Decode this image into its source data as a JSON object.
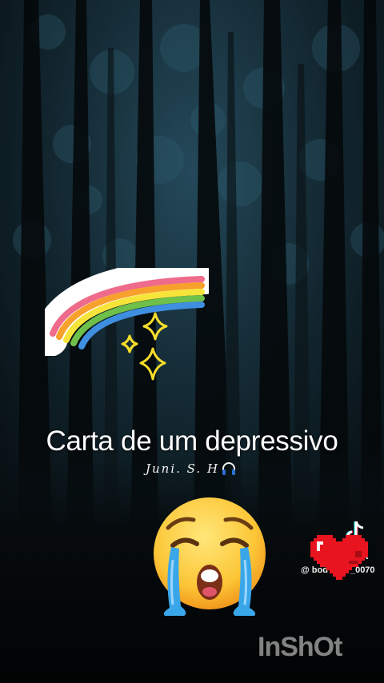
{
  "caption": "Carta de um depressivo",
  "signature": "Juni. S. H",
  "tiktok": {
    "brand": "ok",
    "handle": "@ bod",
    "handle_suffix": "_0070"
  },
  "inshot_watermark": "InShOt",
  "icons": [
    "rainbow-sticker",
    "sparkles-sticker",
    "crying-face-emoji",
    "pixel-heart-sticker",
    "headphones-icon",
    "tiktok-logo"
  ]
}
